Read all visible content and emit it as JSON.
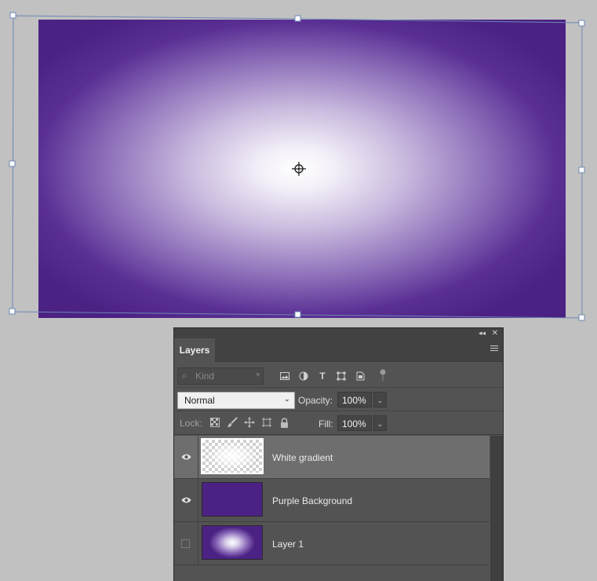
{
  "panel": {
    "tab_label": "Layers",
    "filter": {
      "kind_placeholder": "Kind"
    },
    "blend_mode": "Normal",
    "opacity_label": "Opacity:",
    "opacity_value": "100%",
    "lock_label": "Lock:",
    "fill_label": "Fill:",
    "fill_value": "100%",
    "layers": [
      {
        "name": "White gradient",
        "visible": true,
        "selected": true
      },
      {
        "name": "Purple Background",
        "visible": true,
        "selected": false
      },
      {
        "name": "Layer 1",
        "visible": false,
        "selected": false
      }
    ]
  },
  "colors": {
    "canvas_purple": "#4b2283",
    "canvas_center": "#ffffff",
    "panel_bg": "#535353",
    "selected_row": "#6e6e6e",
    "bbox": "#6b87b5"
  },
  "icons": {
    "filter": [
      "image-filter-icon",
      "adjustment-filter-icon",
      "type-filter-icon",
      "shape-filter-icon",
      "smart-object-filter-icon"
    ],
    "lock": [
      "lock-transparent-icon",
      "lock-image-icon",
      "lock-position-icon",
      "lock-artboard-icon",
      "lock-all-icon"
    ]
  }
}
